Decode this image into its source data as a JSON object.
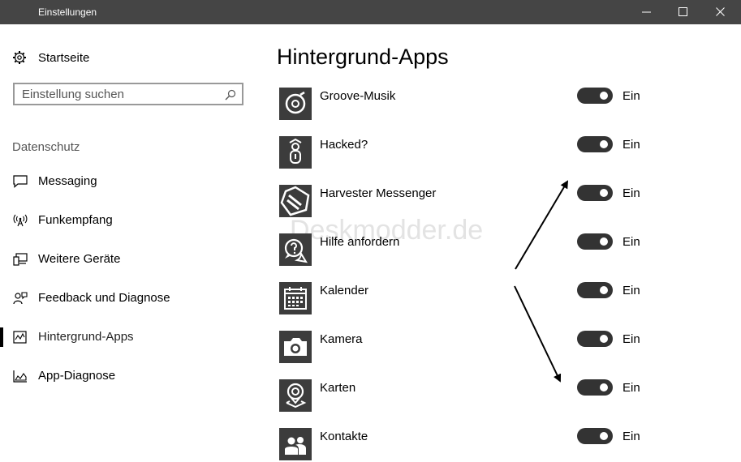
{
  "window": {
    "title": "Einstellungen"
  },
  "sidebar": {
    "home_label": "Startseite",
    "search_placeholder": "Einstellung suchen",
    "section_label": "Datenschutz",
    "items": [
      {
        "label": "Messaging",
        "icon": "chat-icon"
      },
      {
        "label": "Funkempfang",
        "icon": "radio-tower-icon"
      },
      {
        "label": "Weitere Geräte",
        "icon": "devices-icon"
      },
      {
        "label": "Feedback und Diagnose",
        "icon": "feedback-person-icon"
      },
      {
        "label": "Hintergrund-Apps",
        "icon": "background-apps-icon",
        "selected": true
      },
      {
        "label": "App-Diagnose",
        "icon": "app-diagnostics-icon"
      }
    ]
  },
  "main": {
    "title": "Hintergrund-Apps",
    "watermark": "Deskmodder.de",
    "apps": [
      {
        "name": "Groove-Musik",
        "icon": "groove-music-icon",
        "state_label": "Ein",
        "on": true
      },
      {
        "name": "Hacked?",
        "icon": "hacked-icon",
        "state_label": "Ein",
        "on": true
      },
      {
        "name": "Harvester Messenger",
        "icon": "harvester-icon",
        "state_label": "Ein",
        "on": true
      },
      {
        "name": "Hilfe anfordern",
        "icon": "help-chat-icon",
        "state_label": "Ein",
        "on": true
      },
      {
        "name": "Kalender",
        "icon": "calendar-icon",
        "state_label": "Ein",
        "on": true
      },
      {
        "name": "Kamera",
        "icon": "camera-icon",
        "state_label": "Ein",
        "on": true
      },
      {
        "name": "Karten",
        "icon": "maps-icon",
        "state_label": "Ein",
        "on": true
      },
      {
        "name": "Kontakte",
        "icon": "contacts-icon",
        "state_label": "Ein",
        "on": true
      }
    ]
  },
  "colors": {
    "titlebar": "#454545",
    "toggle_on": "#333333",
    "app_tile": "#3c3c3c"
  }
}
